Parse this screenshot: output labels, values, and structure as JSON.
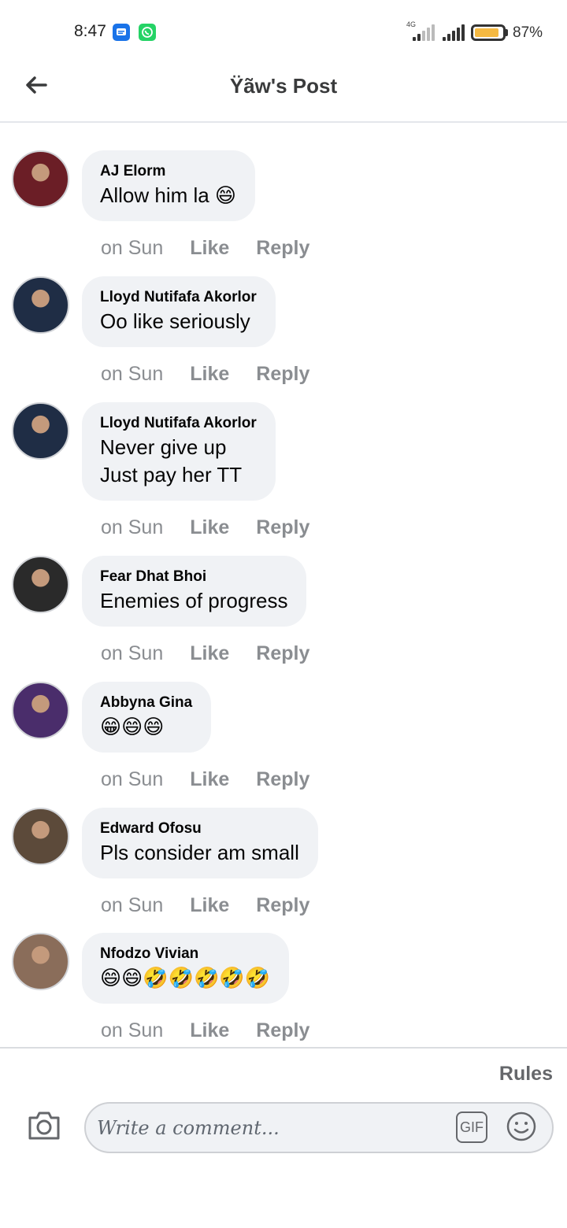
{
  "status_bar": {
    "time": "8:47",
    "network": "4G",
    "battery_level": 0.87,
    "battery_text": "87%",
    "app_icons": [
      "messages-icon",
      "whatsapp-icon"
    ]
  },
  "header": {
    "title": "Ÿãw's Post",
    "back_icon": "arrow-left-icon"
  },
  "comments": [
    {
      "author": "AJ Elorm",
      "text": "Allow him la 😄",
      "time": "on Sun",
      "like": "Like",
      "reply": "Reply",
      "avatar_color": "#6b1e26"
    },
    {
      "author": "Lloyd Nutifafa Akorlor",
      "text": "Oo like seriously",
      "time": "on Sun",
      "like": "Like",
      "reply": "Reply",
      "avatar_color": "#1f2d45"
    },
    {
      "author": "Lloyd Nutifafa Akorlor",
      "text": "Never give up\nJust pay her TT",
      "time": "on Sun",
      "like": "Like",
      "reply": "Reply",
      "avatar_color": "#1f2d45"
    },
    {
      "author": "Fear Dhat Bhoi",
      "text": "Enemies of progress",
      "time": "on Sun",
      "like": "Like",
      "reply": "Reply",
      "avatar_color": "#2a2a2a"
    },
    {
      "author": "Abbyna Gina",
      "text": "😁😄😄",
      "time": "on Sun",
      "like": "Like",
      "reply": "Reply",
      "avatar_color": "#4a2d6b"
    },
    {
      "author": "Edward Ofosu",
      "text": "Pls consider am small",
      "time": "on Sun",
      "like": "Like",
      "reply": "Reply",
      "avatar_color": "#5c4a3a"
    },
    {
      "author": "Nfodzo Vivian",
      "text": "😄😄🤣🤣🤣🤣🤣",
      "time": "on Sun",
      "like": "Like",
      "reply": "Reply",
      "avatar_color": "#8a6d5a"
    }
  ],
  "footer": {
    "rules_label": "Rules",
    "comment_placeholder": "Write a comment...",
    "gif_label": "GIF",
    "camera_icon": "camera-icon",
    "emoji_icon": "smiley-icon"
  }
}
